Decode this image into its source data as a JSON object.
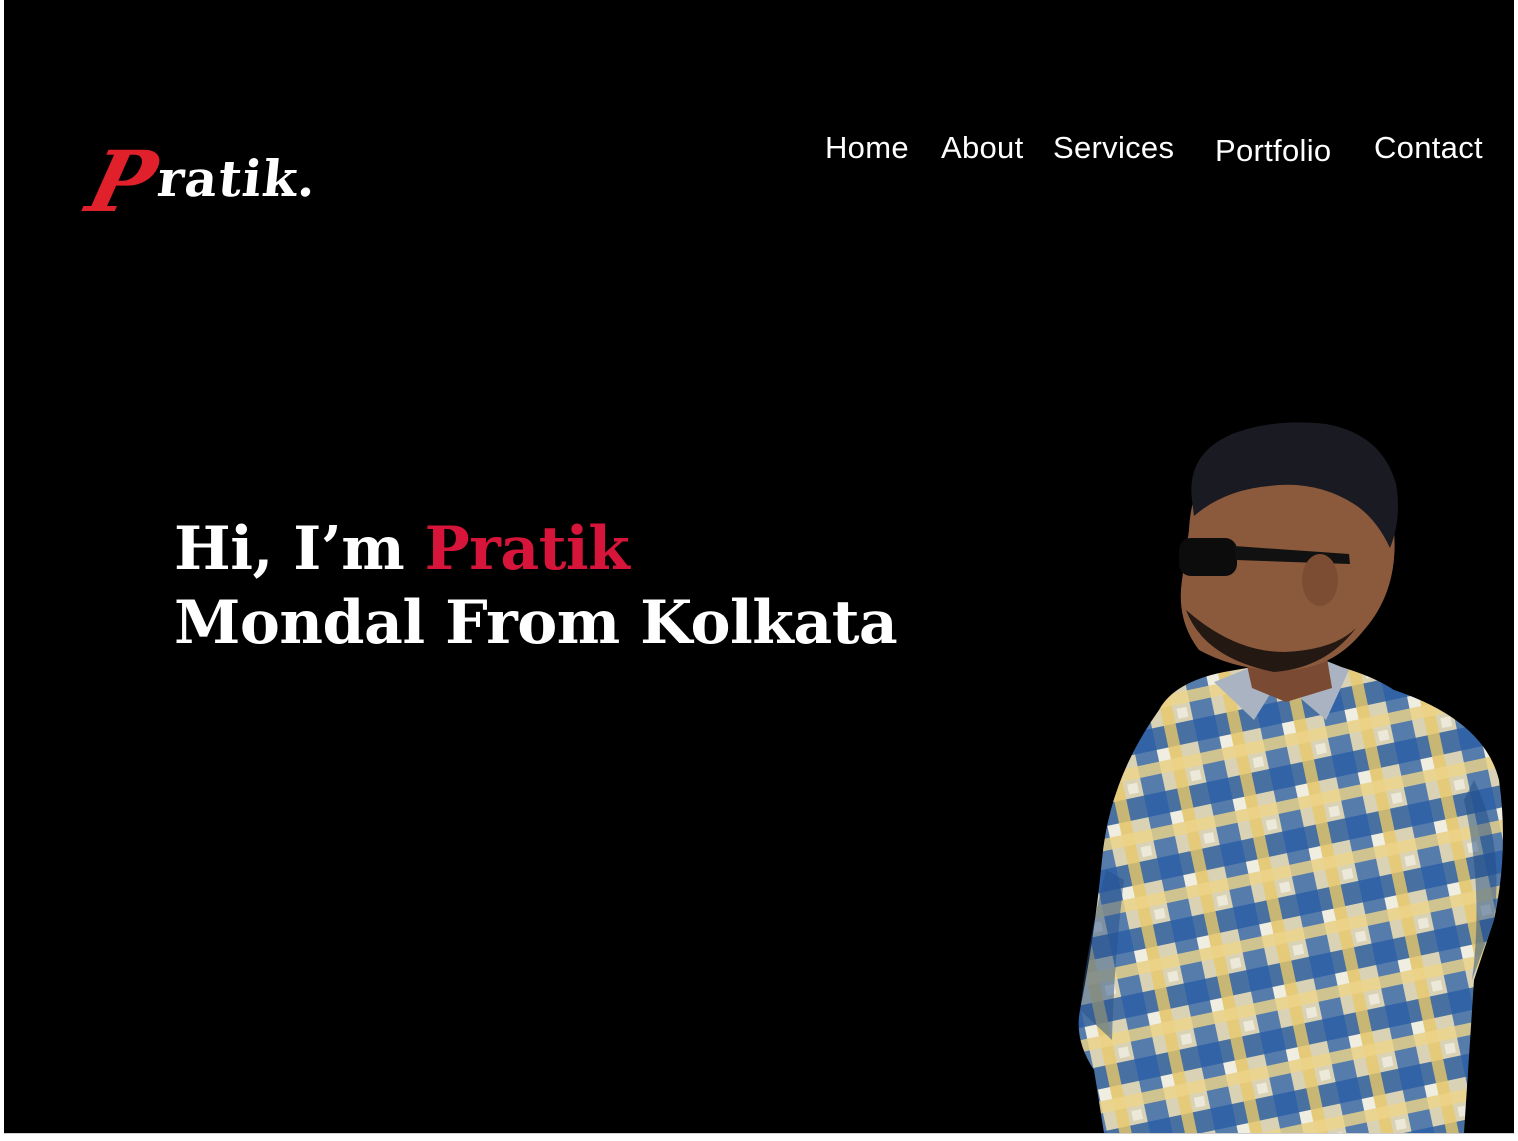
{
  "brand": {
    "logo_initial": "P",
    "logo_rest": "ratik.",
    "accent_color": "#d7153a",
    "text_color": "#ffffff",
    "background": "#000000"
  },
  "nav": {
    "items": [
      {
        "label": "Home"
      },
      {
        "label": "About"
      },
      {
        "label": "Services"
      },
      {
        "label": "Portfolio"
      },
      {
        "label": "Contact"
      }
    ]
  },
  "hero": {
    "greeting": "Hi, I’m ",
    "first_name": "Pratik",
    "line2": "Mondal From Kolkata"
  },
  "portrait": {
    "icon": "person-photo-icon"
  }
}
